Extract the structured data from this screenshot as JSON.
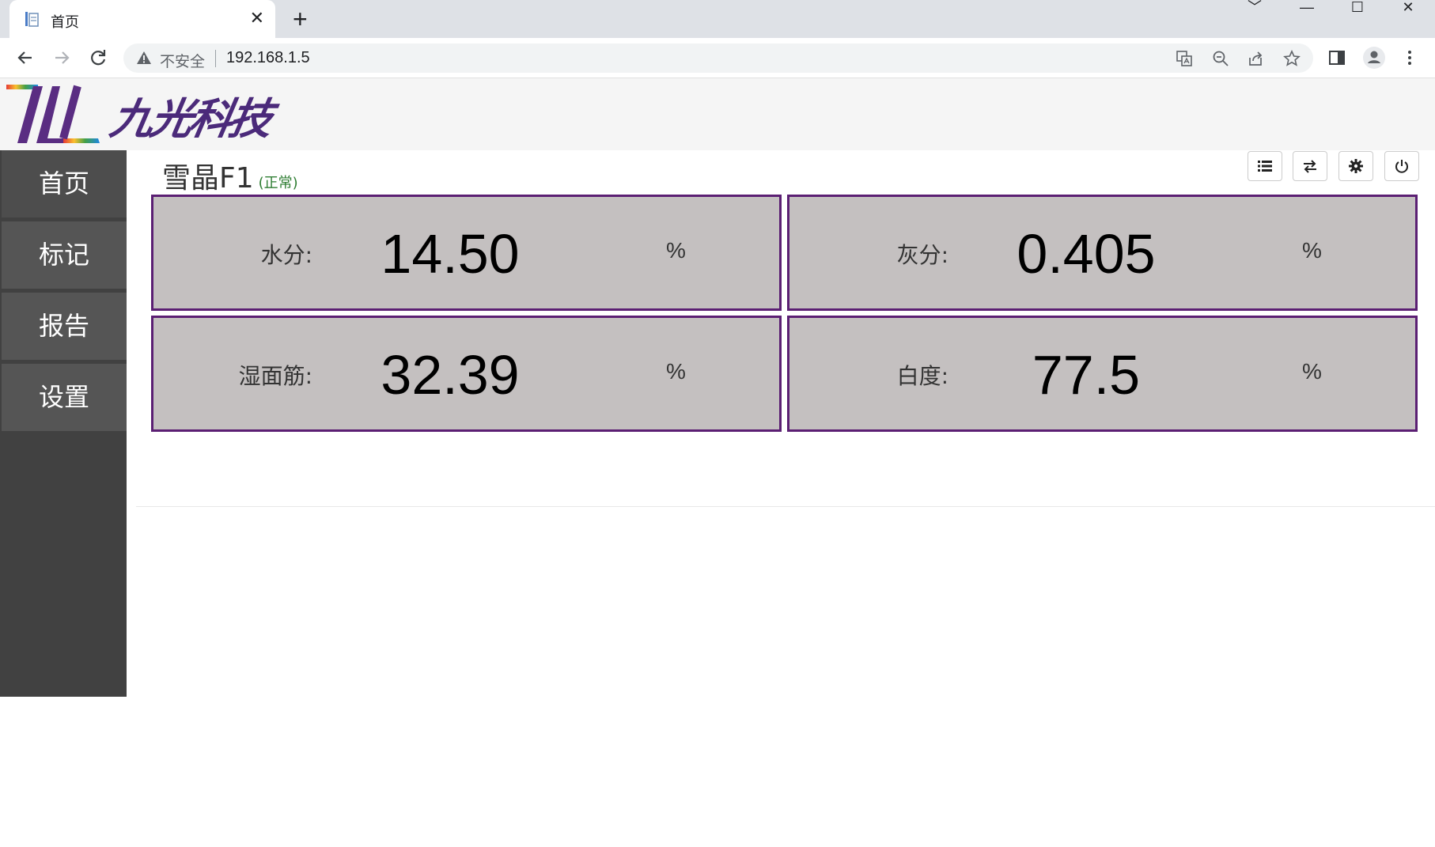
{
  "browser": {
    "tab_title": "首页",
    "tab_close": "✕",
    "new_tab": "+",
    "window_controls": [
      "﹀",
      "—",
      "☐",
      "✕"
    ],
    "insecure_label": "不安全",
    "url": "192.168.1.5",
    "icons": [
      "back-icon",
      "forward-icon",
      "reload-icon",
      "warning-icon",
      "translate-icon",
      "zoom-icon",
      "share-icon",
      "bookmark-star-icon",
      "side-panel-icon",
      "profile-icon",
      "menu-icon"
    ]
  },
  "app": {
    "logo_text": "九光科技",
    "logo_mark": "NL",
    "sidebar": {
      "items": [
        {
          "label": "首页"
        },
        {
          "label": "标记"
        },
        {
          "label": "报告"
        },
        {
          "label": "设置"
        }
      ]
    },
    "device": {
      "name": "雪晶F1",
      "status": "(正常)"
    },
    "actions": [
      "list-icon",
      "transfer-icon",
      "gear-icon",
      "power-icon"
    ],
    "readings": [
      {
        "label": "水分:",
        "value": "14.50",
        "unit": "%"
      },
      {
        "label": "灰分:",
        "value": "0.405",
        "unit": "%"
      },
      {
        "label": "湿面筋:",
        "value": "32.39",
        "unit": "%"
      },
      {
        "label": "白度:",
        "value": "77.5",
        "unit": "%"
      }
    ],
    "colors": {
      "card_bg": "#c4c0c0",
      "card_border": "#5b1f73",
      "sidebar_bg": "#414141",
      "status_ok": "#2e7d32"
    }
  }
}
